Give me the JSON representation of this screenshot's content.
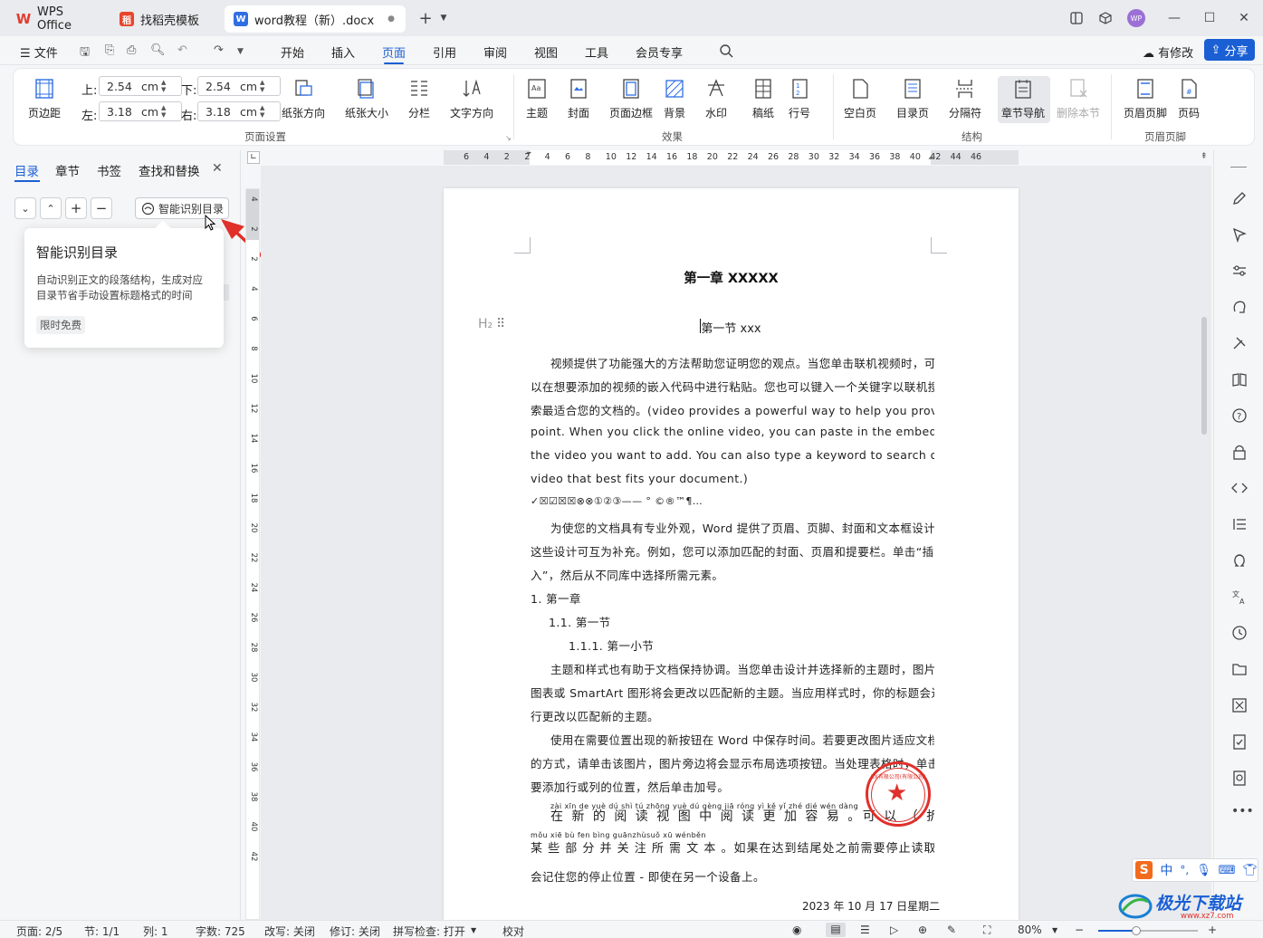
{
  "tabs": [
    {
      "label": "WPS Office"
    },
    {
      "label": "找稻壳模板"
    },
    {
      "label": "word教程（新）.docx"
    }
  ],
  "menu": {
    "file": "文件",
    "items": [
      "开始",
      "插入",
      "页面",
      "引用",
      "审阅",
      "视图",
      "工具",
      "会员专享"
    ],
    "selected": "页面",
    "has_changes": "有修改",
    "share": "分享"
  },
  "ribbon": {
    "margins": "页边距",
    "top_label": "上:",
    "top_value": "2.54",
    "bottom_label": "下:",
    "bottom_value": "2.54",
    "left_label": "左:",
    "left_value": "3.18",
    "right_label": "右:",
    "right_value": "3.18",
    "unit": "cm",
    "orientation": "纸张方向",
    "size": "纸张大小",
    "columns": "分栏",
    "text_direction": "文字方向",
    "group_page_setup": "页面设置",
    "theme": "主题",
    "cover": "封面",
    "border": "页面边框",
    "background": "背景",
    "watermark": "水印",
    "manuscript": "稿纸",
    "line_no": "行号",
    "group_effect": "效果",
    "blank_page": "空白页",
    "toc_page": "目录页",
    "separator": "分隔符",
    "section_nav": "章节导航",
    "delete_section": "删除本节",
    "group_structure": "结构",
    "header_footer": "页眉页脚",
    "page_number": "页码",
    "group_header_footer": "页眉页脚"
  },
  "left_panel": {
    "tabs": [
      "目录",
      "章节",
      "书签",
      "查找和替换"
    ],
    "active_tab": "目录",
    "ai_button": "智能识别目录",
    "tooltip_title": "智能识别目录",
    "tooltip_body_1": "自动识别正文的段落结构，生成对应",
    "tooltip_body_2": "目录节省手动设置标题格式的时间",
    "tooltip_badge": "限时免费"
  },
  "ruler": {
    "h_ticks": [
      "6",
      "4",
      "2",
      "2",
      "4",
      "6",
      "8",
      "10",
      "12",
      "14",
      "16",
      "18",
      "20",
      "22",
      "24",
      "26",
      "28",
      "30",
      "32",
      "34",
      "36",
      "38",
      "40",
      "42",
      "44",
      "46"
    ],
    "v_ticks": [
      "4",
      "2",
      "2",
      "4",
      "6",
      "8",
      "10",
      "12",
      "14",
      "16",
      "18",
      "20",
      "22",
      "24",
      "26",
      "28",
      "30",
      "32",
      "34",
      "36",
      "38",
      "40",
      "42"
    ]
  },
  "document": {
    "chapter_title": "第一章  XXXXX",
    "heading_marker": "H₂",
    "section_title": "第一节  xxx",
    "lines": [
      "视频提供了功能强大的方法帮助您证明您的观点。当您单击联机视频时，可",
      "以在想要添加的视频的嵌入代码中进行粘贴。您也可以键入一个关键字以联机搜",
      "索最适合您的文档的。(video provides a powerful way to help you prove your",
      "point. When you click the online video, you can paste in the embedding code for",
      "the video you want to add. You can also type a keyword to search online for the",
      "video that best fits your document.)",
      "✓☒☑☒☒⊗⊗①②③——    °  ©®™¶…",
      "为使您的文档具有专业外观，Word 提供了页眉、页脚、封面和文本框设计，",
      "这些设计可互为补充。例如，您可以添加匹配的封面、页眉和提要栏。单击“插",
      "入”，然后从不同库中选择所需元素。",
      "1.   第一章",
      "1.1.  第一节",
      "1.1.1.   第一小节",
      "主题和样式也有助于文档保持协调。当您单击设计并选择新的主题时，图片、",
      "图表或 SmartArt 图形将会更改以匹配新的主题。当应用样式时，你的标题会进",
      "行更改以匹配新的主题。",
      "使用在需要位置出现的新按钮在 Word 中保存时间。若要更改图片适应文档",
      "的方式，请单击该图片，图片旁边将会显示布局选项按钮。当处理表格时，单击",
      "要添加行或列的位置，然后单击加号。",
      "zài  xīn  de  yuè  dú  shì  tú   zhōng yuè  dú  gèng  jiā  róng   yì      kě     yǐ              zhé  dié  wén  dàng",
      "在 新 的 阅 读 视 图 中 阅 读 更 加 容 易 。可 以 （ 折 叠 文 档 ）",
      "mǒu xiē  bù  fen bìng guānzhùsuǒ  xū  wénběn",
      "某 些 部 分 并 关 注 所 需 文 本 。如果在达到结尾处之前需要停止读取，Word",
      "会记住您的停止位置 - 即使在另一个设备上。",
      "2023 年 10 月 17 日星期二"
    ],
    "stamp_text": "XX有限公司(有限公司)"
  },
  "status": {
    "page": "页面: 2/5",
    "section": "节: 1/1",
    "column": "列: 1",
    "words": "字数: 725",
    "overtype": "改写: 关闭",
    "track": "修订: 关闭",
    "spell": "拼写检查: 打开",
    "proof": "校对",
    "zoom": "80%"
  },
  "watermark_brand": "极光下载站",
  "watermark_url": "www.xz7.com",
  "ime": {
    "lang": "中"
  },
  "colors": {
    "accent": "#1a5fd4",
    "arrow": "#e0302a",
    "stamp": "#e0302a"
  }
}
